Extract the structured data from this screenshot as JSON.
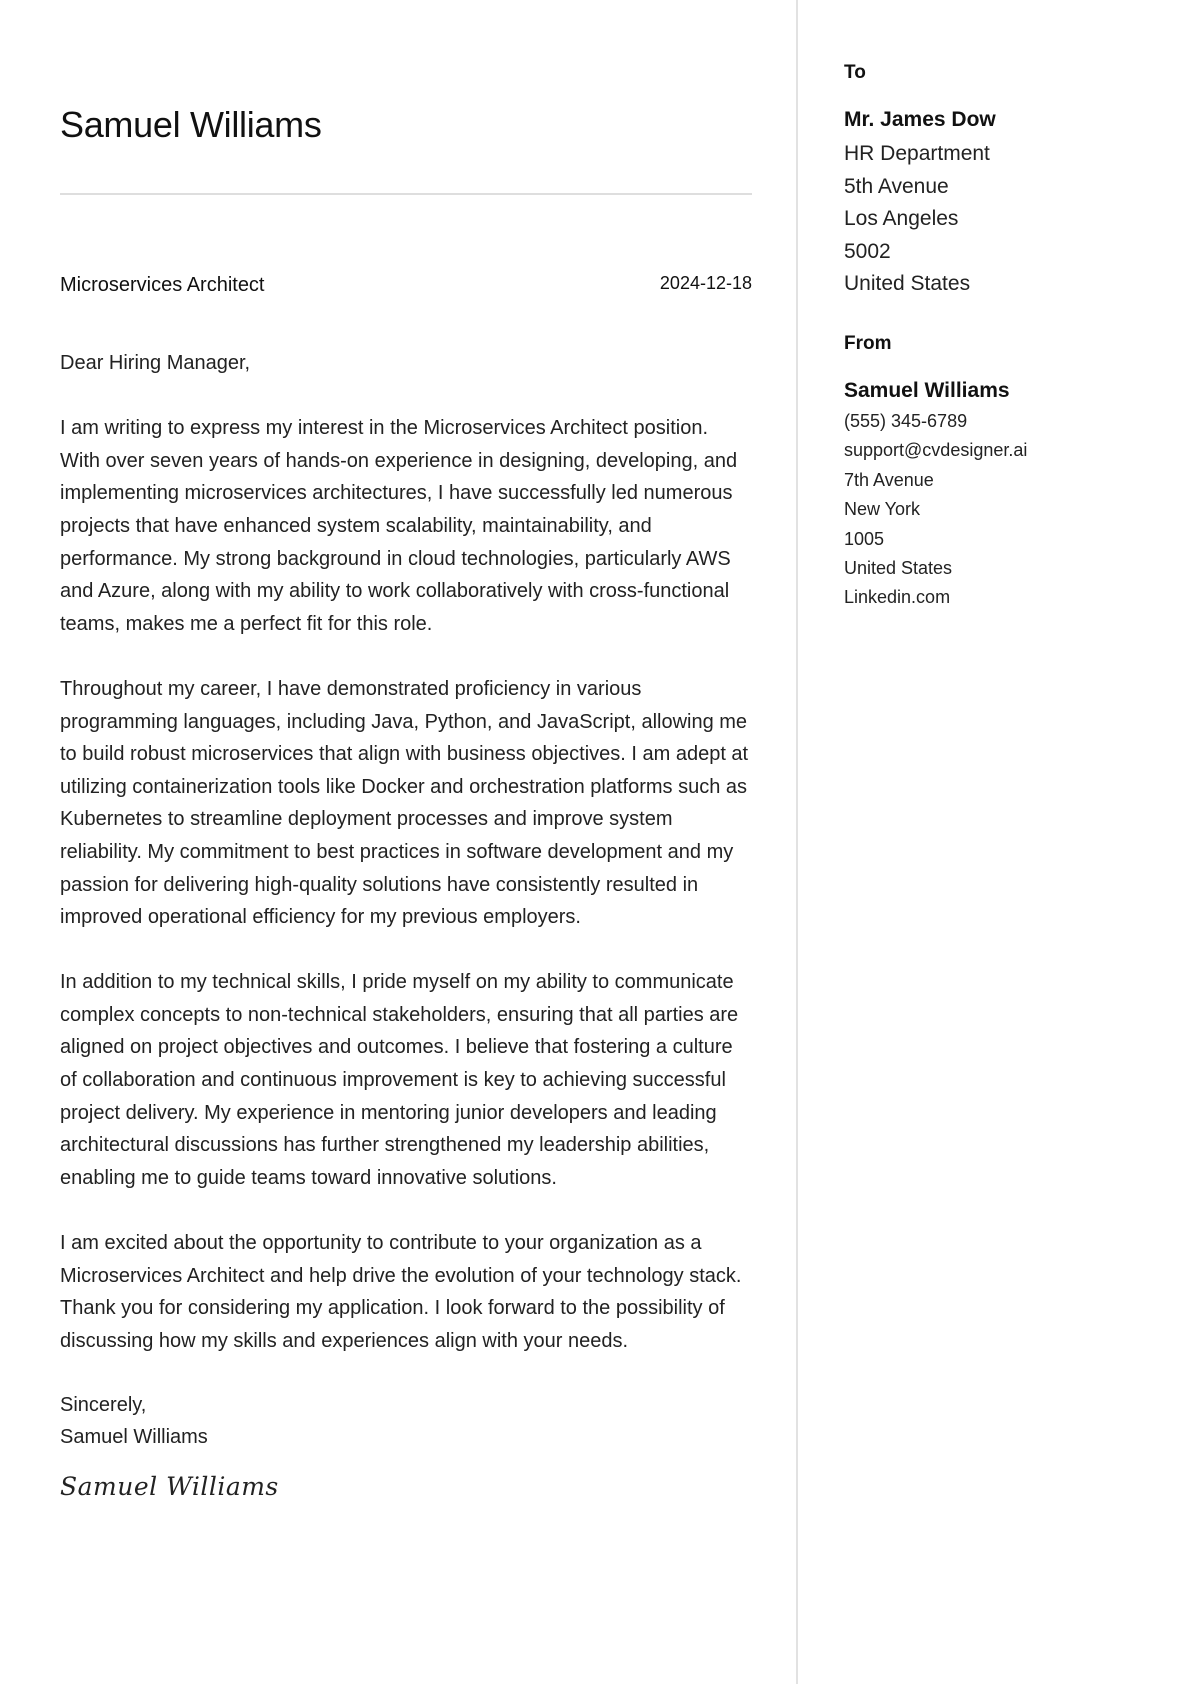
{
  "header": {
    "name": "Samuel Williams",
    "job_title": "Microservices Architect",
    "date": "2024-12-18"
  },
  "letter": {
    "salutation": "Dear Hiring Manager,",
    "paragraphs": [
      "I am writing to express my interest in the Microservices Architect position. With over seven years of hands-on experience in designing, developing, and implementing microservices architectures, I have successfully led numerous projects that have enhanced system scalability, maintainability, and performance. My strong background in cloud technologies, particularly AWS and Azure, along with my ability to work collaboratively with cross-functional teams, makes me a perfect fit for this role.",
      "Throughout my career, I have demonstrated proficiency in various programming languages, including Java, Python, and JavaScript, allowing me to build robust microservices that align with business objectives. I am adept at utilizing containerization tools like Docker and orchestration platforms such as Kubernetes to streamline deployment processes and improve system reliability. My commitment to best practices in software development and my passion for delivering high-quality solutions have consistently resulted in improved operational efficiency for my previous employers.",
      "In addition to my technical skills, I pride myself on my ability to communicate complex concepts to non-technical stakeholders, ensuring that all parties are aligned on project objectives and outcomes. I believe that fostering a culture of collaboration and continuous improvement is key to achieving successful project delivery. My experience in mentoring junior developers and leading architectural discussions has further strengthened my leadership abilities, enabling me to guide teams toward innovative solutions.",
      "I am excited about the opportunity to contribute to your organization as a Microservices Architect and help drive the evolution of your technology stack. Thank you for considering my application. I look forward to the possibility of discussing how my skills and experiences align with your needs."
    ],
    "closing": "Sincerely,",
    "closing_name": "Samuel Williams",
    "signature": "Samuel Williams"
  },
  "recipient": {
    "label": "To",
    "name": "Mr. James Dow",
    "lines": [
      "HR Department",
      "5th Avenue",
      "Los Angeles",
      "5002",
      "United States"
    ]
  },
  "sender": {
    "label": "From",
    "name": "Samuel Williams",
    "phone": "(555) 345-6789",
    "email": "support@cvdesigner.ai",
    "street": "7th Avenue",
    "city": "New York",
    "postal_code": "1005",
    "country": "United States",
    "website": "Linkedin.com"
  }
}
